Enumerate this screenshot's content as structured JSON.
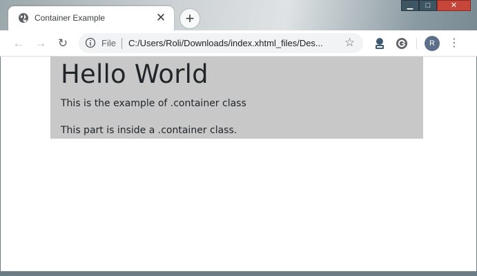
{
  "browser": {
    "tab": {
      "title": "Container Example",
      "close_glyph": "✕",
      "favicon": "globe-icon"
    },
    "new_tab_glyph": "+",
    "window_controls": {
      "minimize_glyph": "▁",
      "maximize_glyph": "□",
      "close_glyph": "✕"
    },
    "toolbar": {
      "back_glyph": "←",
      "forward_glyph": "→",
      "reload_glyph": "↻",
      "scheme_label": "File",
      "url": "C:/Users/Roli/Downloads/index.xhtml_files/Des...",
      "bookmark_glyph": "☆",
      "profile_initial": "R",
      "menu_glyph": "⋮"
    }
  },
  "page": {
    "heading": "Hello World",
    "paragraph_1": "This is the example of .container class",
    "paragraph_2": "This part is inside a .container class."
  },
  "colors": {
    "container_background": "#c8c8c8",
    "text": "#212529",
    "avatar": "#5b6f8a",
    "close_button": "#c7463a"
  }
}
